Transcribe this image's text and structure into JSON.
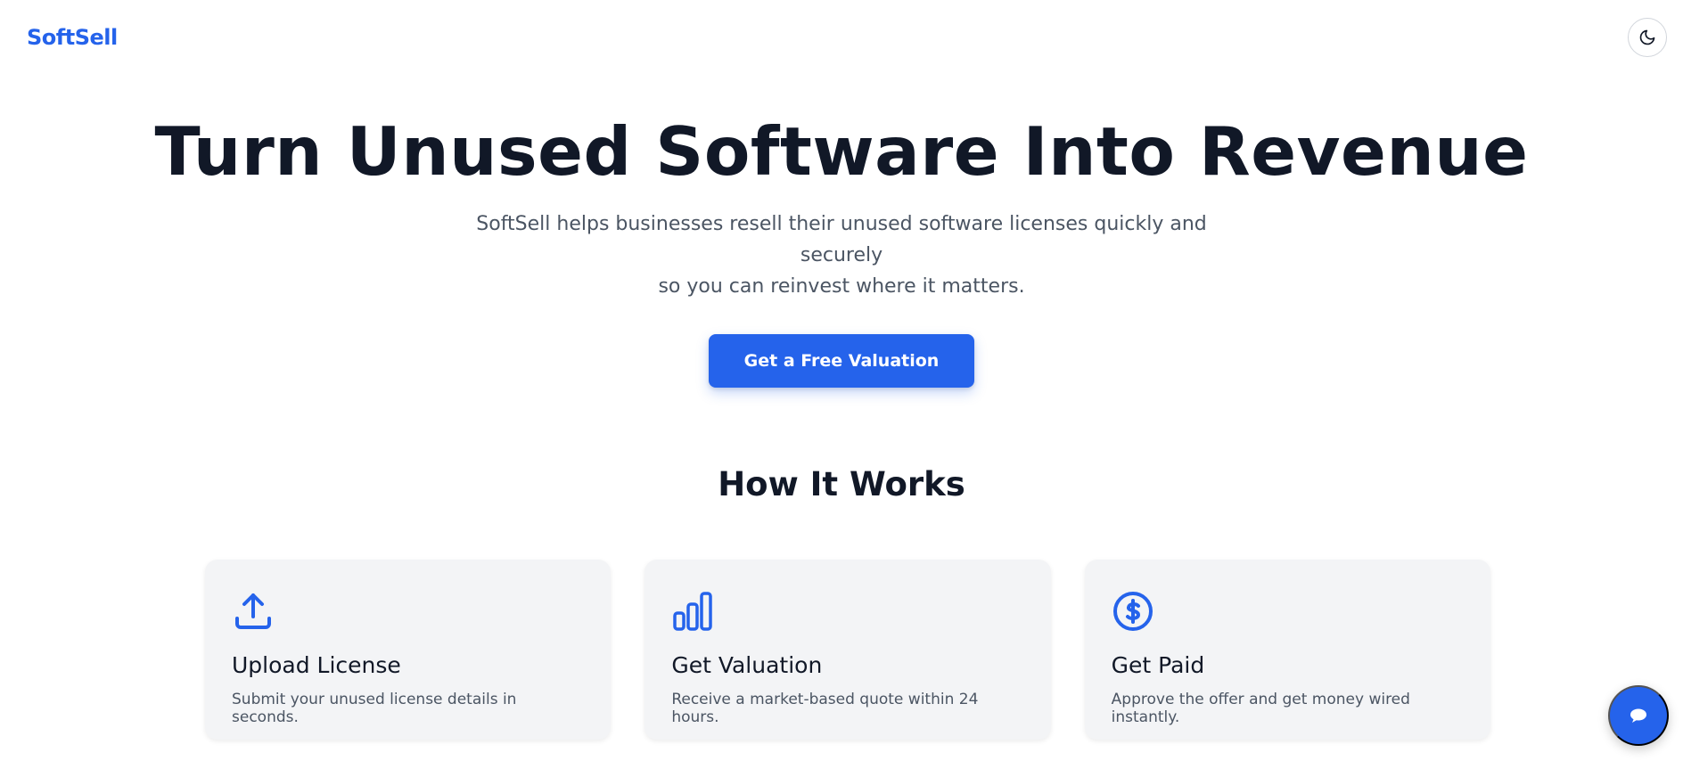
{
  "header": {
    "logo": "SoftSell",
    "theme_toggle_icon": "moon-icon"
  },
  "hero": {
    "title": "Turn Unused Software Into Revenue",
    "subtitle_line1": "SoftSell helps businesses resell their unused software licenses quickly and securely",
    "subtitle_line2": "so you can reinvest where it matters.",
    "cta_label": "Get a Free Valuation"
  },
  "how_it_works": {
    "title": "How It Works",
    "steps": [
      {
        "icon": "upload-icon",
        "title": "Upload License",
        "description": "Submit your unused license details in seconds."
      },
      {
        "icon": "bar-chart-icon",
        "title": "Get Valuation",
        "description": "Receive a market-based quote within 24 hours."
      },
      {
        "icon": "dollar-circle-icon",
        "title": "Get Paid",
        "description": "Approve the offer and get money wired instantly."
      }
    ]
  },
  "chat": {
    "icon": "chat-bubble-icon"
  },
  "colors": {
    "accent": "#2563eb",
    "heading": "#111827",
    "body_text": "#4b5563",
    "card_bg": "#f3f4f6"
  }
}
